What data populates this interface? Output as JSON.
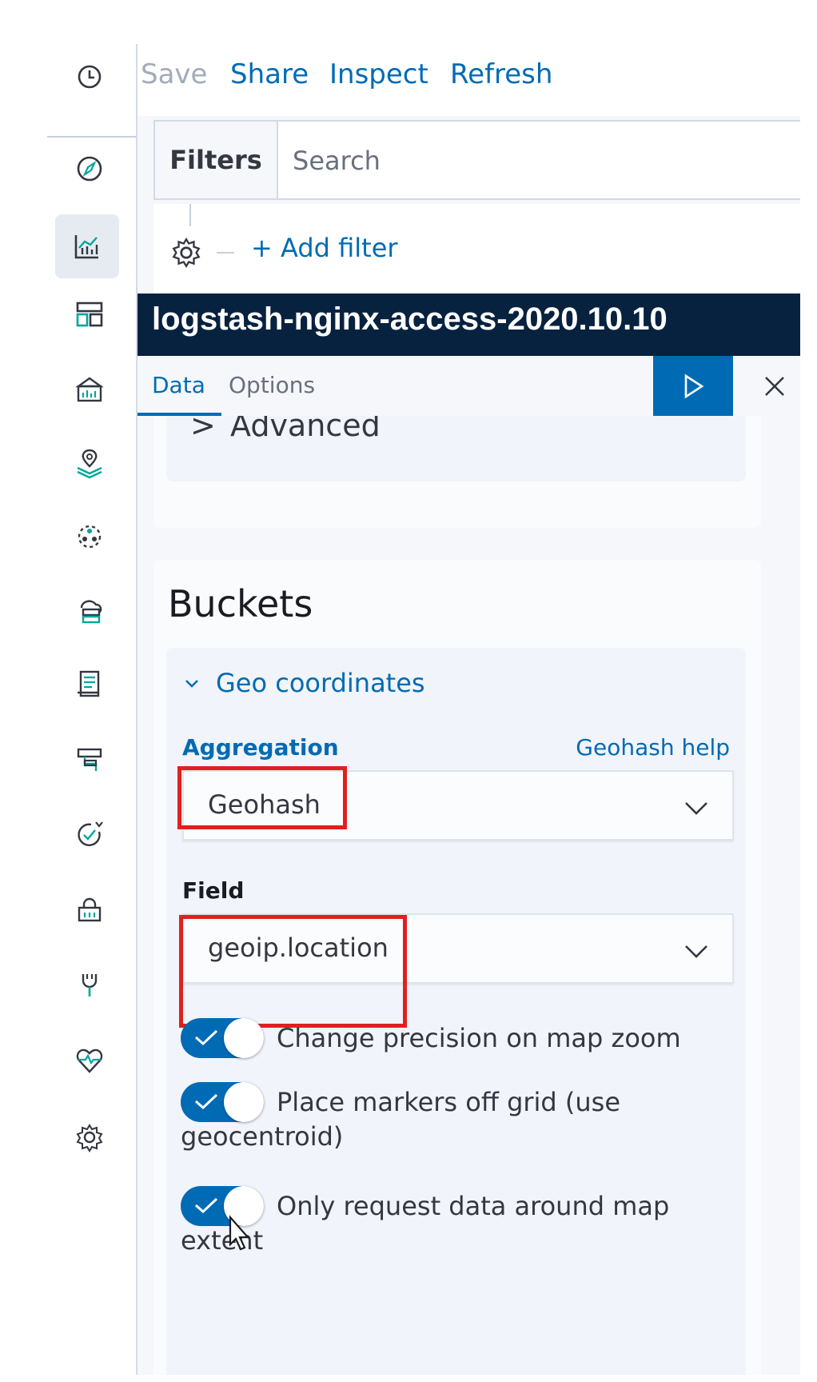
{
  "rail": {
    "icons": [
      "clock-icon",
      "compass-icon",
      "visualize-icon",
      "dashboard-icon",
      "canvas-icon",
      "maps-icon",
      "machine-learning-icon",
      "infrastructure-icon",
      "logs-icon",
      "apm-icon",
      "uptime-icon",
      "siem-icon",
      "dev-tools-icon",
      "monitoring-icon",
      "management-icon"
    ],
    "active": "visualize-icon"
  },
  "topnav": {
    "save": "Save",
    "share": "Share",
    "inspect": "Inspect",
    "refresh": "Refresh"
  },
  "filters": {
    "tab_label": "Filters",
    "search_placeholder": "Search",
    "add_filter": "+ Add filter"
  },
  "title": "logstash-nginx-access-2020.10.10",
  "tabs": {
    "data": "Data",
    "options": "Options"
  },
  "advanced": {
    "label": "Advanced",
    "chevron": ">"
  },
  "buckets": {
    "title": "Buckets",
    "group_label": "Geo coordinates",
    "aggregation_label": "Aggregation",
    "geohash_help": "Geohash help",
    "aggregation_value": "Geohash",
    "field_label": "Field",
    "field_value": "geoip.location",
    "toggles": [
      {
        "label_line1": "Change precision on map zoom",
        "label_line2": "",
        "on": true
      },
      {
        "label_line1": "Place markers off grid (use",
        "label_line2": "geocentroid)",
        "on": true
      },
      {
        "label_line1": "Only request data around map",
        "label_line2": "extent",
        "on": true
      }
    ]
  },
  "colors": {
    "primary": "#006bb4",
    "nav_dark": "#07223f",
    "highlight": "#e02020"
  }
}
